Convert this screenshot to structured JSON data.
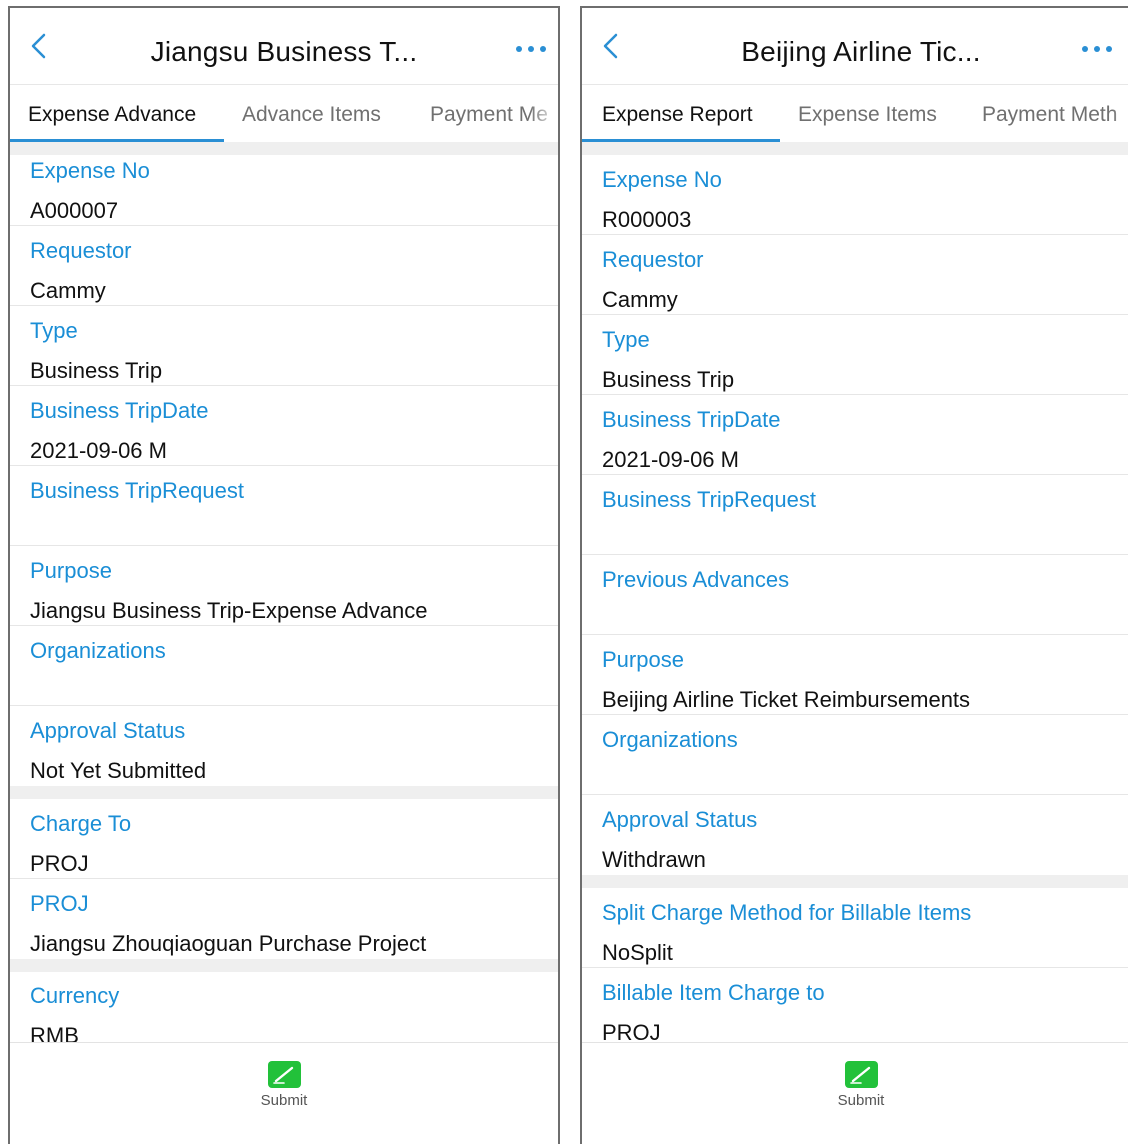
{
  "left_screen": {
    "title": "Jiangsu Business T...",
    "tabs": [
      "Expense Advance",
      "Advance Items",
      "Payment Me"
    ],
    "fields": [
      {
        "label": "Expense No",
        "value": "A000007"
      },
      {
        "label": "Requestor",
        "value": "Cammy"
      },
      {
        "label": "Type",
        "value": "Business Trip"
      },
      {
        "label": "Business TripDate",
        "value": "2021-09-06 M"
      },
      {
        "label": "Business TripRequest",
        "value": ""
      },
      {
        "label": "Purpose",
        "value": "Jiangsu Business Trip-Expense Advance"
      },
      {
        "label": "Organizations",
        "value": ""
      },
      {
        "label": "Approval Status",
        "value": "Not Yet Submitted"
      },
      {
        "label": "Charge To",
        "value": "PROJ"
      },
      {
        "label": "PROJ",
        "value": "Jiangsu Zhouqiaoguan Purchase Project"
      },
      {
        "label": "Currency",
        "value": "RMB"
      }
    ],
    "submit_label": "Submit"
  },
  "right_screen": {
    "title": "Beijing Airline Tic...",
    "tabs": [
      "Expense Report",
      "Expense Items",
      "Payment Meth"
    ],
    "fields": [
      {
        "label": "Expense No",
        "value": "R000003"
      },
      {
        "label": "Requestor",
        "value": "Cammy"
      },
      {
        "label": "Type",
        "value": "Business Trip"
      },
      {
        "label": "Business TripDate",
        "value": "2021-09-06 M"
      },
      {
        "label": "Business TripRequest",
        "value": ""
      },
      {
        "label": "Previous Advances",
        "value": ""
      },
      {
        "label": "Purpose",
        "value": "Beijing Airline Ticket Reimbursements"
      },
      {
        "label": "Organizations",
        "value": ""
      },
      {
        "label": "Approval Status",
        "value": "Withdrawn"
      },
      {
        "label": "Split Charge Method for Billable Items",
        "value": "NoSplit"
      },
      {
        "label": "Billable Item Charge to",
        "value": "PROJ"
      }
    ],
    "submit_label": "Submit"
  },
  "colors": {
    "accent": "#2a8fd4",
    "label_blue": "#1a8ed6",
    "submit_green": "#22c13a",
    "section_gray": "#efefef"
  },
  "icons": {
    "back": "chevron-left-icon",
    "more": "more-dots-icon",
    "submit": "submit-pen-icon"
  }
}
